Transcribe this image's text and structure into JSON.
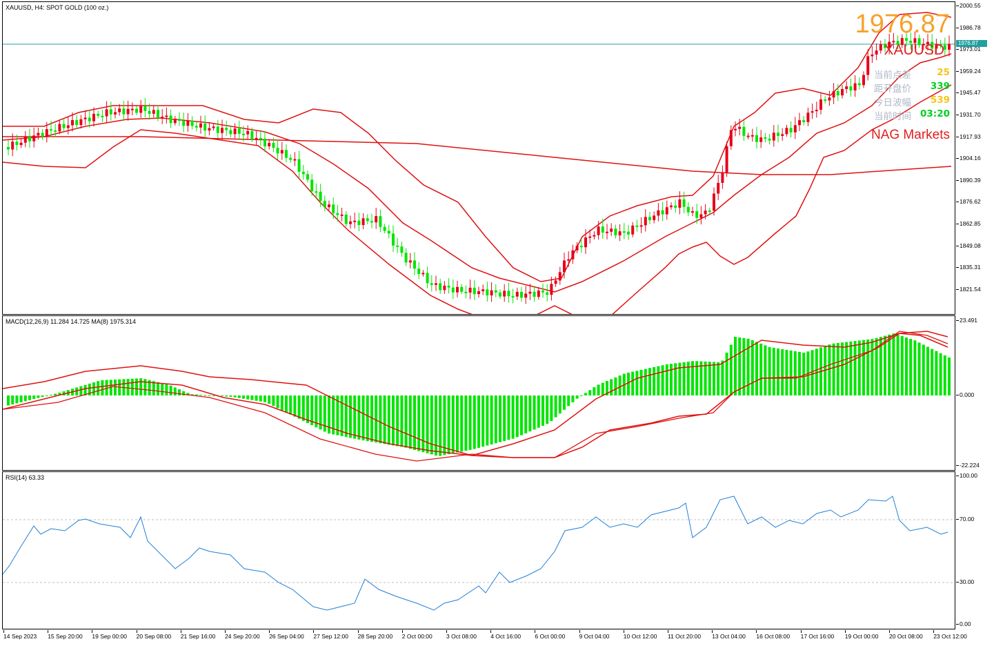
{
  "main_chart": {
    "header": "XAUUSD, H4:  SPOT GOLD (100 oz.)",
    "current_price_tag": "1976.87",
    "price_ticks": [
      "2000.55",
      "1986.78",
      "1973.01",
      "1959.24",
      "1945.47",
      "1931.70",
      "1917.93",
      "1904.16",
      "1890.39",
      "1876.62",
      "1862.85",
      "1849.08",
      "1835.31",
      "1821.54"
    ],
    "colors": {
      "bull": "#00e600",
      "bear": "#e6001a",
      "bands": "#e01010",
      "price_line": "#20a0a0"
    }
  },
  "overlay": {
    "price": "1976.87",
    "symbol": "XAUUSD",
    "rows": [
      {
        "label": "当前点差",
        "value": "25",
        "color": "#f5c518"
      },
      {
        "label": "距开盘价",
        "value": "339",
        "color": "#00d020"
      },
      {
        "label": "今日波幅",
        "value": "539",
        "color": "#f5c518"
      },
      {
        "label": "当前时间",
        "value": "03:20",
        "color": "#00d020"
      }
    ],
    "brand": "NAG Markets"
  },
  "macd_panel": {
    "header": "MACD(12,26,9) 11.284 14.725 MA(8) 1975.314",
    "ticks": [
      "23.491",
      "0.000",
      "-22.224"
    ]
  },
  "rsi_panel": {
    "header": "RSI(14) 63.33",
    "ticks": [
      "100.00",
      "70.00",
      "30.00",
      "0.00"
    ]
  },
  "time_axis": [
    "14 Sep 2023",
    "15 Sep 20:00",
    "19 Sep 00:00",
    "20 Sep 08:00",
    "21 Sep 16:00",
    "24 Sep 20:00",
    "26 Sep 04:00",
    "27 Sep 12:00",
    "28 Sep 20:00",
    "2 Oct 00:00",
    "3 Oct 08:00",
    "4 Oct 16:00",
    "6 Oct 00:00",
    "9 Oct 04:00",
    "10 Oct 12:00",
    "11 Oct 20:00",
    "13 Oct 04:00",
    "16 Oct 08:00",
    "17 Oct 16:00",
    "19 Oct 00:00",
    "20 Oct 08:00",
    "23 Oct 12:00"
  ]
}
